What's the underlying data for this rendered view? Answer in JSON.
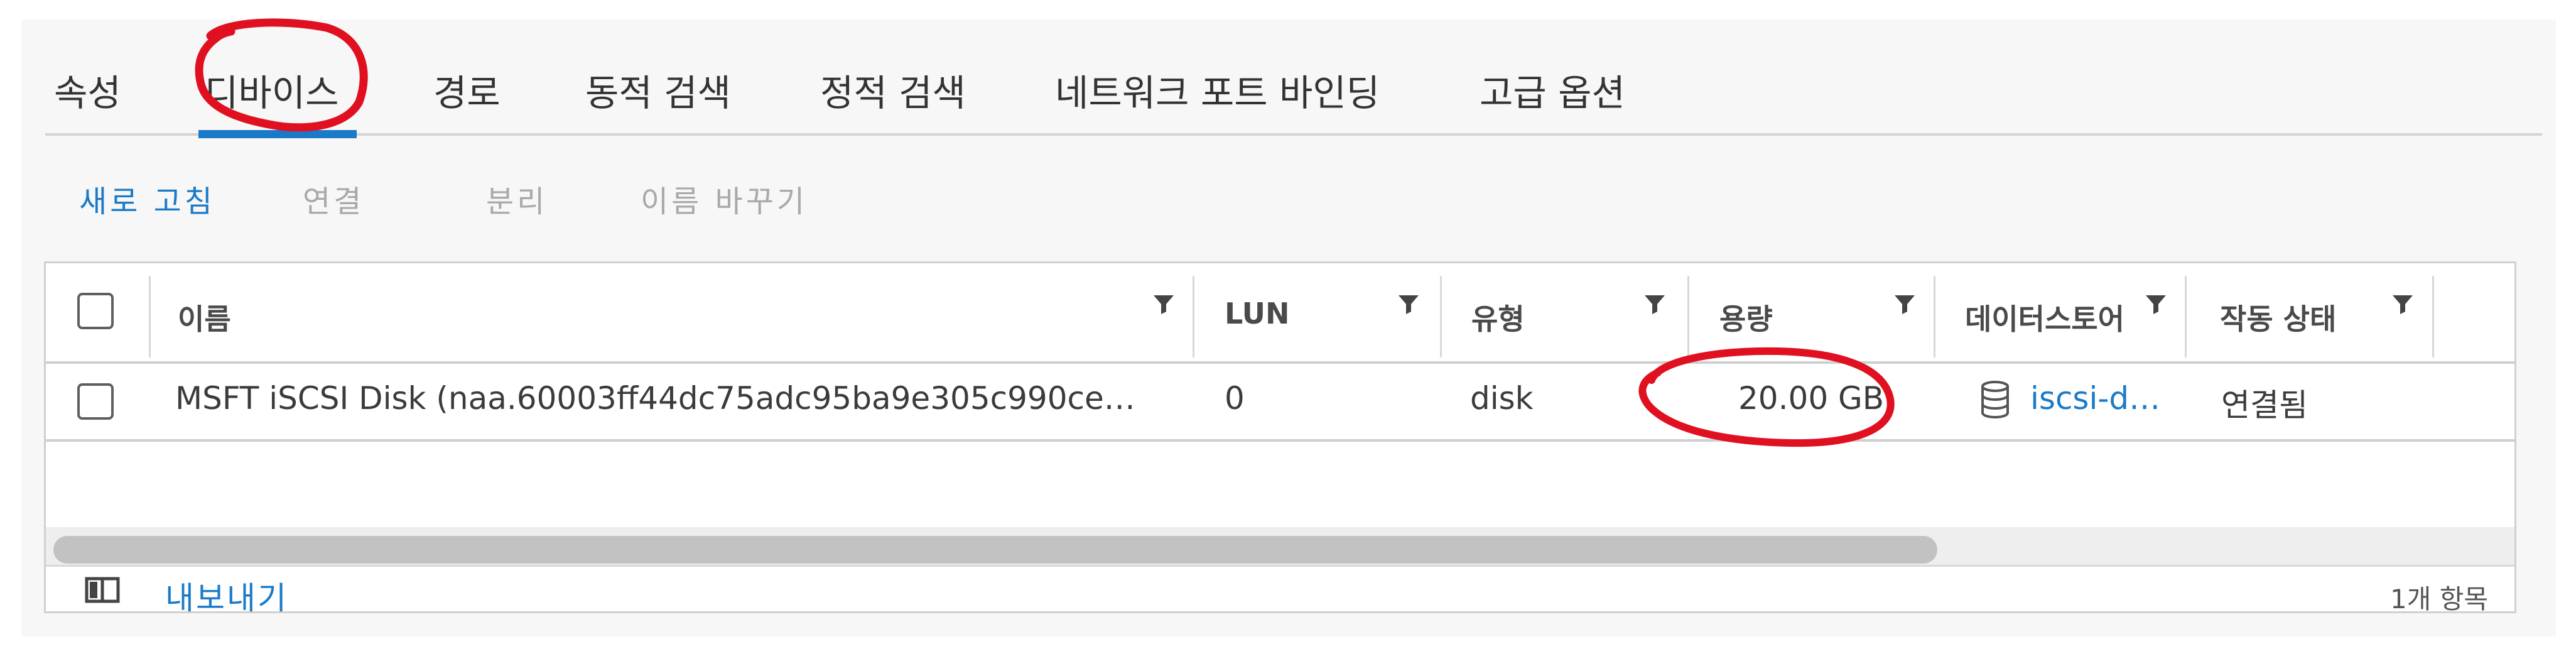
{
  "tabs": [
    {
      "label": "속성"
    },
    {
      "label": "디바이스"
    },
    {
      "label": "경로"
    },
    {
      "label": "동적 검색"
    },
    {
      "label": "정적 검색"
    },
    {
      "label": "네트워크 포트 바인딩"
    },
    {
      "label": "고급 옵션"
    }
  ],
  "active_tab": "디바이스",
  "toolbar": {
    "refresh": "새로 고침",
    "attach": "연결",
    "detach": "분리",
    "rename": "이름 바꾸기"
  },
  "grid": {
    "columns": [
      "이름",
      "LUN",
      "유형",
      "용량",
      "데이터스토어",
      "작동 상태"
    ],
    "rows": [
      {
        "name": "MSFT iSCSI Disk (naa.60003ff44dc75adc95ba9e305c990ce…",
        "lun": "0",
        "type": "disk",
        "capacity": "20.00 GB",
        "datastore": "iscsi-datas…",
        "status": "연결됨"
      }
    ]
  },
  "footer": {
    "export": "내보내기",
    "count": "1개 항목"
  },
  "colors": {
    "accent": "#1b7ac7",
    "annotation": "#e01020"
  }
}
